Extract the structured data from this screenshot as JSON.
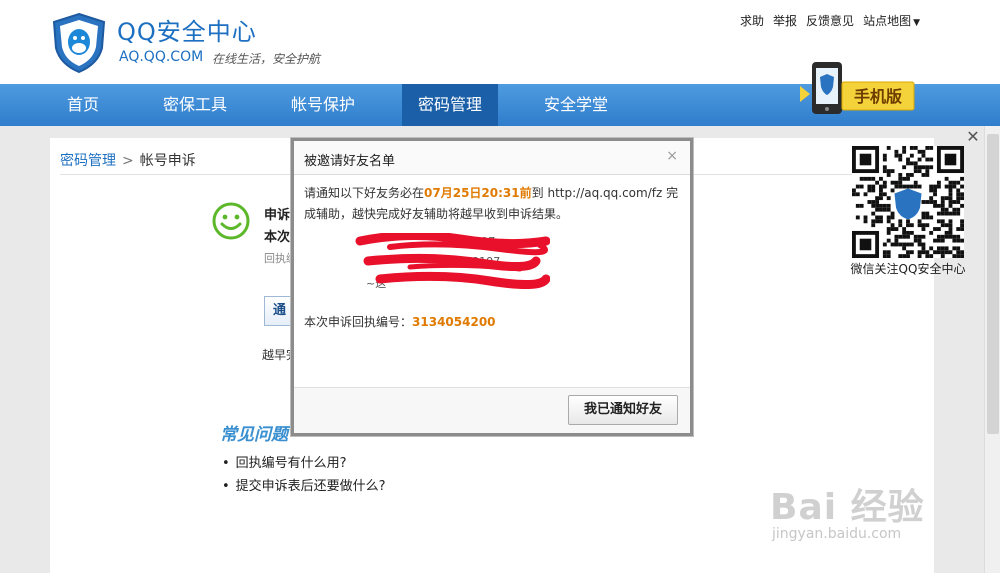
{
  "header": {
    "title": "QQ安全中心",
    "domain": "AQ.QQ.COM",
    "slogan": "在线生活，安全护航",
    "top_links": [
      "求助",
      "举报",
      "反馈意见",
      "站点地图"
    ]
  },
  "nav": {
    "items": [
      {
        "label": "首页"
      },
      {
        "label": "密保工具"
      },
      {
        "label": "帐号保护"
      },
      {
        "label": "密码管理",
        "active": true
      },
      {
        "label": "安全学堂"
      }
    ],
    "mobile_badge": "手机版"
  },
  "breadcrumb": {
    "parent": "密码管理",
    "separator": ">",
    "current": "帐号申诉"
  },
  "result": {
    "title_partial": "申诉",
    "sub_partial": "本次",
    "small_partial": "回执编",
    "notify_button_partial": "通",
    "soon_partial": "越早完"
  },
  "faq": {
    "title": "常见问题",
    "items": [
      "回执编号有什么用?",
      "提交申诉表后还要做什么?"
    ]
  },
  "qr": {
    "caption": "微信关注QQ安全中心"
  },
  "modal": {
    "title": "被邀请好友名单",
    "close": "×",
    "intro_prefix": "请通知以下好友务必在",
    "deadline": "07月25日20:31前",
    "intro_mid": "到",
    "url": "http://aq.qq.com/fz",
    "intro_suffix": "完成辅助，越快完成好友辅助将越早收到申诉结果。",
    "friends": [
      "(317",
      "(2197",
      "~这"
    ],
    "receipt_label": "本次申诉回执编号：",
    "receipt_number": "3134054200",
    "confirm_button": "我已通知好友"
  },
  "watermark": {
    "brand": "Bai 经验",
    "url": "jingyan.baidu.com"
  },
  "colors": {
    "nav_blue": "#2f7dcc",
    "nav_active": "#1a5fa8",
    "brand_blue": "#1d6fc1",
    "highlight_orange": "#e07a00",
    "scribble_red": "#e8102a"
  }
}
